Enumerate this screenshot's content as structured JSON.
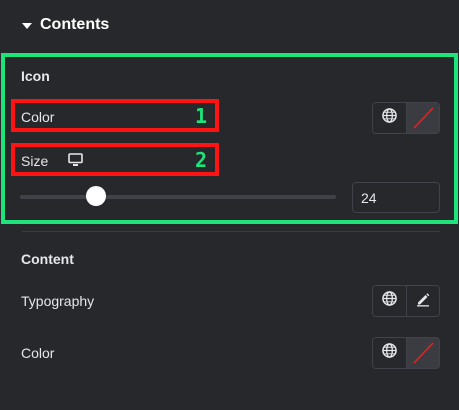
{
  "header": {
    "title": "Contents"
  },
  "icon_group": {
    "title": "Icon",
    "color_label": "Color",
    "color_marker": "1",
    "size_label": "Size",
    "size_marker": "2",
    "size_value": "24",
    "slider_fraction": 0.24
  },
  "content_group": {
    "title": "Content",
    "typography_label": "Typography",
    "color_label": "Color"
  },
  "colors": {
    "highlight_green": "#1ee27a",
    "highlight_red": "#ff1414",
    "background": "#27282c"
  }
}
